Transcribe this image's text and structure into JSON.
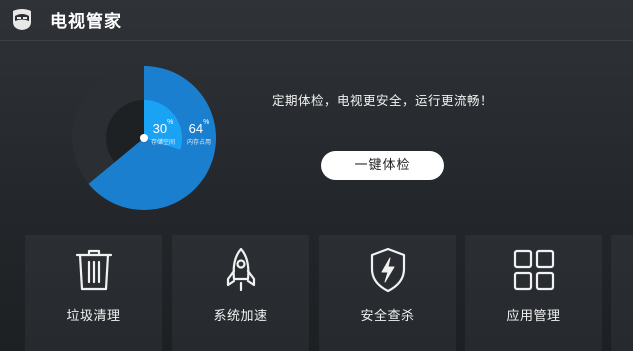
{
  "app": {
    "title": "电视管家",
    "logo_icon": "tv-butler-logo-icon"
  },
  "gauge": {
    "storage_percent": 30,
    "storage_label": "存储空间",
    "memory_percent": 64,
    "memory_label": "内存占用",
    "colors": {
      "outer": "#1b7fd0",
      "inner": "#1aa3f5",
      "track": "#2b2e32"
    }
  },
  "checkup": {
    "tagline": "定期体检，电视更安全，运行更流畅！",
    "button_label": "一键体检"
  },
  "tiles": [
    {
      "label": "垃圾清理",
      "icon": "trash-icon"
    },
    {
      "label": "系统加速",
      "icon": "rocket-icon"
    },
    {
      "label": "安全查杀",
      "icon": "shield-lightning-icon"
    },
    {
      "label": "应用管理",
      "icon": "app-grid-icon"
    }
  ]
}
